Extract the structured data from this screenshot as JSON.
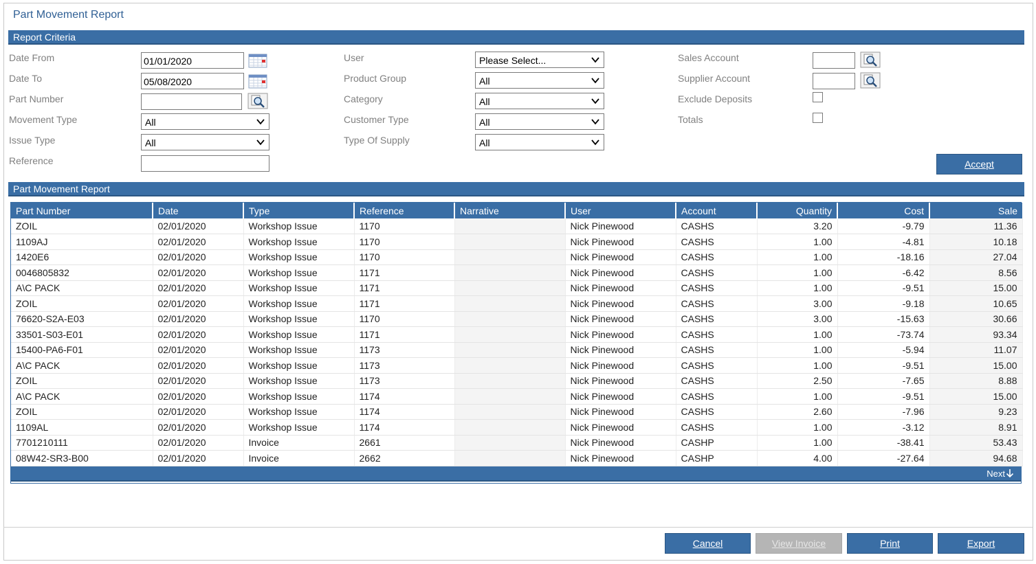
{
  "window_title": "Part Movement Report",
  "criteria": {
    "section_title": "Report Criteria",
    "date_from": {
      "label": "Date From",
      "value": "01/01/2020"
    },
    "date_to": {
      "label": "Date To",
      "value": "05/08/2020"
    },
    "part_number": {
      "label": "Part Number",
      "value": ""
    },
    "movement_type": {
      "label": "Movement Type",
      "value": "All"
    },
    "issue_type": {
      "label": "Issue Type",
      "value": "All"
    },
    "reference": {
      "label": "Reference",
      "value": ""
    },
    "user": {
      "label": "User",
      "value": "Please Select..."
    },
    "product_group": {
      "label": "Product Group",
      "value": "All"
    },
    "category": {
      "label": "Category",
      "value": "All"
    },
    "customer_type": {
      "label": "Customer Type",
      "value": "All"
    },
    "type_of_supply": {
      "label": "Type Of Supply",
      "value": "All"
    },
    "sales_account": {
      "label": "Sales Account",
      "value": ""
    },
    "supplier_account": {
      "label": "Supplier Account",
      "value": ""
    },
    "exclude_deposits": {
      "label": "Exclude Deposits",
      "checked": false
    },
    "totals": {
      "label": "Totals",
      "checked": false
    },
    "accept_label": "Accept"
  },
  "report": {
    "section_title": "Part Movement Report",
    "columns": [
      "Part Number",
      "Date",
      "Type",
      "Reference",
      "Narrative",
      "User",
      "Account",
      "Quantity",
      "Cost",
      "Sale"
    ],
    "rows": [
      [
        "ZOIL",
        "02/01/2020",
        "Workshop Issue",
        "1170",
        "",
        "Nick Pinewood",
        "CASHS",
        "3.20",
        "-9.79",
        "11.36"
      ],
      [
        "1109AJ",
        "02/01/2020",
        "Workshop Issue",
        "1170",
        "",
        "Nick Pinewood",
        "CASHS",
        "1.00",
        "-4.81",
        "10.18"
      ],
      [
        "1420E6",
        "02/01/2020",
        "Workshop Issue",
        "1170",
        "",
        "Nick Pinewood",
        "CASHS",
        "1.00",
        "-18.16",
        "27.04"
      ],
      [
        "0046805832",
        "02/01/2020",
        "Workshop Issue",
        "1171",
        "",
        "Nick Pinewood",
        "CASHS",
        "1.00",
        "-6.42",
        "8.56"
      ],
      [
        "A\\C PACK",
        "02/01/2020",
        "Workshop Issue",
        "1171",
        "",
        "Nick Pinewood",
        "CASHS",
        "1.00",
        "-9.51",
        "15.00"
      ],
      [
        "ZOIL",
        "02/01/2020",
        "Workshop Issue",
        "1171",
        "",
        "Nick Pinewood",
        "CASHS",
        "3.00",
        "-9.18",
        "10.65"
      ],
      [
        "76620-S2A-E03",
        "02/01/2020",
        "Workshop Issue",
        "1170",
        "",
        "Nick Pinewood",
        "CASHS",
        "3.00",
        "-15.63",
        "30.66"
      ],
      [
        "33501-S03-E01",
        "02/01/2020",
        "Workshop Issue",
        "1171",
        "",
        "Nick Pinewood",
        "CASHS",
        "1.00",
        "-73.74",
        "93.34"
      ],
      [
        "15400-PA6-F01",
        "02/01/2020",
        "Workshop Issue",
        "1173",
        "",
        "Nick Pinewood",
        "CASHS",
        "1.00",
        "-5.94",
        "11.07"
      ],
      [
        "A\\C PACK",
        "02/01/2020",
        "Workshop Issue",
        "1173",
        "",
        "Nick Pinewood",
        "CASHS",
        "1.00",
        "-9.51",
        "15.00"
      ],
      [
        "ZOIL",
        "02/01/2020",
        "Workshop Issue",
        "1173",
        "",
        "Nick Pinewood",
        "CASHS",
        "2.50",
        "-7.65",
        "8.88"
      ],
      [
        "A\\C PACK",
        "02/01/2020",
        "Workshop Issue",
        "1174",
        "",
        "Nick Pinewood",
        "CASHS",
        "1.00",
        "-9.51",
        "15.00"
      ],
      [
        "ZOIL",
        "02/01/2020",
        "Workshop Issue",
        "1174",
        "",
        "Nick Pinewood",
        "CASHS",
        "2.60",
        "-7.96",
        "9.23"
      ],
      [
        "1109AL",
        "02/01/2020",
        "Workshop Issue",
        "1174",
        "",
        "Nick Pinewood",
        "CASHS",
        "1.00",
        "-3.12",
        "8.91"
      ],
      [
        "7701210111",
        "02/01/2020",
        "Invoice",
        "2661",
        "",
        "Nick Pinewood",
        "CASHP",
        "1.00",
        "-38.41",
        "53.43"
      ],
      [
        "08W42-SR3-B00",
        "02/01/2020",
        "Invoice",
        "2662",
        "",
        "Nick Pinewood",
        "CASHP",
        "4.00",
        "-27.64",
        "94.68"
      ]
    ],
    "next_label": "Next"
  },
  "footer": {
    "cancel_label": "Cancel",
    "view_invoice_label": "View Invoice",
    "print_label": "Print",
    "export_label": "Export"
  },
  "colors": {
    "accent": "#3a6ea5",
    "disabled": "#b5b5b5"
  }
}
